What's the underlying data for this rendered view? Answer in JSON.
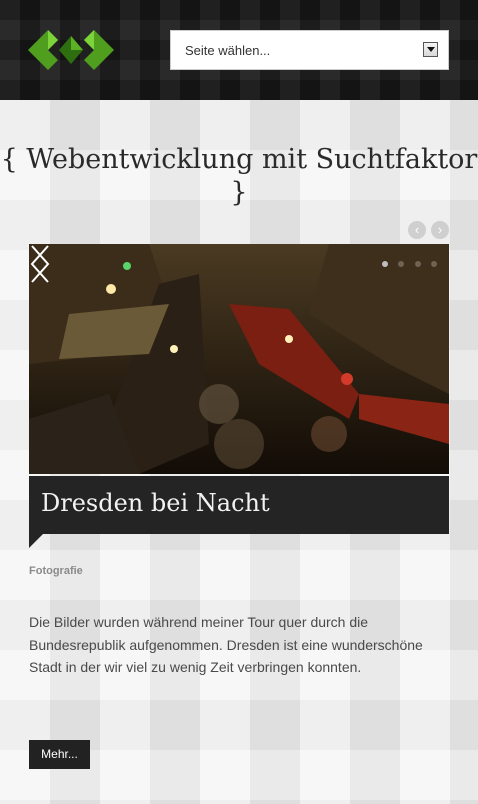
{
  "header": {
    "logo_icon": "green-brackets-logo",
    "select": {
      "value": "Seite wählen...",
      "arrow_icon": "chevron-down-icon"
    }
  },
  "tagline": "{ Webentwicklung mit Suchtfaktor }",
  "slider": {
    "mini_prev": "‹",
    "mini_next": "›",
    "slides_total": 4,
    "active_slide": 1,
    "image": "night-street-photo",
    "caption": "Dresden bei Nacht"
  },
  "post": {
    "category": "Fotografie",
    "description": "Die Bilder wurden während meiner Tour quer durch die Bundesrepublik aufgenommen. Dresden ist eine wunderschöne Stadt in der wir viel zu wenig Zeit verbringen konnten.",
    "more_label": "Mehr..."
  },
  "colors": {
    "logo_green": "#5bb025",
    "dark": "#242424"
  }
}
